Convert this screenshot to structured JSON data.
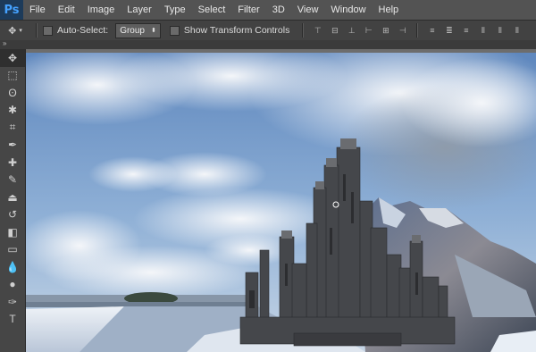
{
  "app": {
    "logo": "Ps"
  },
  "menu": [
    "File",
    "Edit",
    "Image",
    "Layer",
    "Type",
    "Select",
    "Filter",
    "3D",
    "View",
    "Window",
    "Help"
  ],
  "options": {
    "auto_select_label": "Auto-Select:",
    "auto_select_value": "Group",
    "show_transform_label": "Show Transform Controls"
  },
  "toolbar": {
    "tools": [
      "move-tool-icon",
      "marquee-tool-icon",
      "lasso-tool-icon",
      "quick-select-tool-icon",
      "crop-tool-icon",
      "eyedropper-tool-icon",
      "healing-brush-tool-icon",
      "brush-tool-icon",
      "clone-stamp-tool-icon",
      "history-brush-tool-icon",
      "eraser-tool-icon",
      "gradient-tool-icon",
      "blur-tool-icon",
      "dodge-tool-icon",
      "pen-tool-icon",
      "type-tool-icon"
    ]
  },
  "colors": {
    "menubar": "#535353",
    "optionsbar": "#424242",
    "toolbar": "#464646",
    "accent": "#45a2ff"
  }
}
